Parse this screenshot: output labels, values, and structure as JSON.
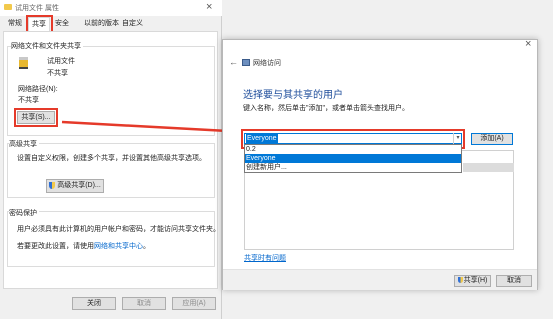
{
  "props_window": {
    "title": "试用文件 属性",
    "close_glyph": "×",
    "tabs": [
      "常规",
      "共享",
      "安全",
      "以前的版本",
      "自定义"
    ],
    "active_tab": "共享",
    "network_section": {
      "title": "网络文件和文件夹共享",
      "item_name": "试用文件",
      "item_status": "不共享",
      "path_label": "网络路径(N):",
      "path_value": "不共享",
      "share_button": "共享(S)..."
    },
    "advanced_section": {
      "title": "高级共享",
      "description": "设置自定义权限，创建多个共享，并设置其他高级共享选项。",
      "button": "高级共享(D)..."
    },
    "password_section": {
      "title": "密码保护",
      "text1": "用户必须具有此计算机的用户帐户和密码，才能访问共享文件夹。",
      "text2_prefix": "若要更改此设置，请使用",
      "text2_link": "网络和共享中心",
      "text2_suffix": "。"
    },
    "buttons": {
      "close": "关闭",
      "cancel": "取消",
      "apply": "应用(A)"
    }
  },
  "share_dialog": {
    "back_glyph": "←",
    "title": "网络访问",
    "close_glyph": "×",
    "heading": "选择要与其共享的用户",
    "instruction": "键入名称，然后单击\"添加\"，或者单击箭头查找用户。",
    "input_value": "Everyone",
    "add_button": "添加(A)",
    "dropdown_options": [
      "0.2",
      "Everyone",
      "创建新用户..."
    ],
    "dropdown_selected_index": 1,
    "help_link": "共享时有问题",
    "share_button": "共享(H)",
    "cancel_button": "取消"
  },
  "colors": {
    "accent": "#0078d7",
    "highlight_red": "#e53a2a",
    "heading_blue": "#1e4d9b",
    "link_blue": "#0066cc"
  }
}
